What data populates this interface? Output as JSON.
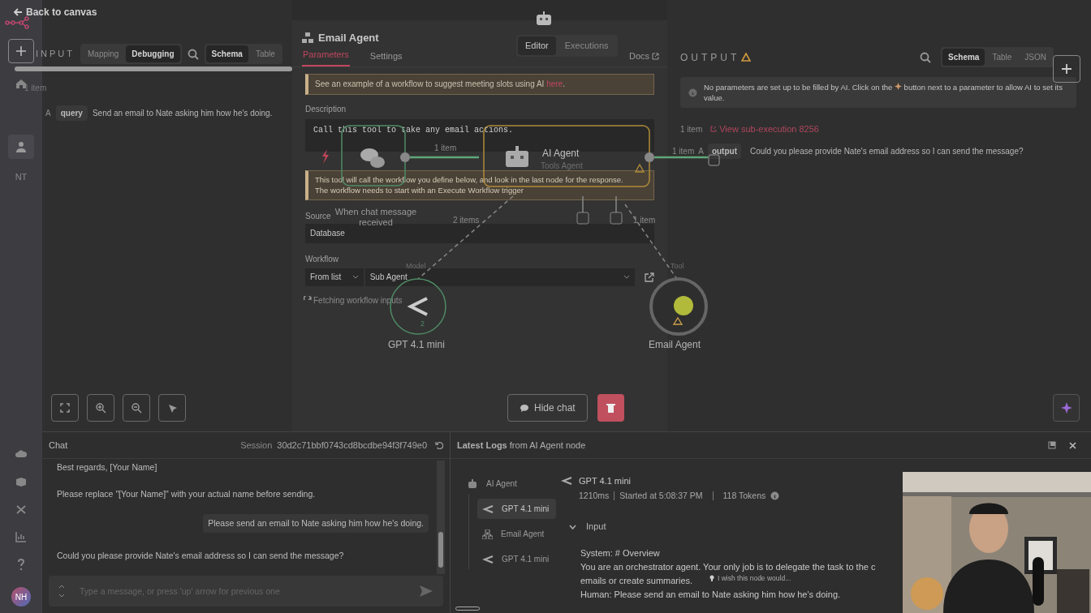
{
  "top_bar": {
    "back_link": "Back to canvas"
  },
  "sidebar": {
    "top_items": [
      {
        "kind": "add",
        "selected": false
      },
      {
        "kind": "home",
        "selected": false
      },
      {
        "kind": "user",
        "selected": true
      }
    ],
    "workspace_label": "NT",
    "bottom_items": [
      {
        "kind": "cloud"
      },
      {
        "kind": "package"
      },
      {
        "kind": "variable"
      },
      {
        "kind": "chart"
      },
      {
        "kind": "help"
      }
    ],
    "avatar_initials": "NH"
  },
  "input_panel": {
    "title": "INPUT",
    "mode_tabs": [
      {
        "label": "Mapping",
        "selected": false
      },
      {
        "label": "Debugging",
        "selected": true
      }
    ],
    "view_tabs": [
      {
        "label": "Schema",
        "selected": true
      },
      {
        "label": "Table",
        "selected": false
      }
    ],
    "item_count": "1 item",
    "fields": [
      {
        "type_marker": "A",
        "name": "query",
        "value": "Send an email to Nate asking him how he's doing."
      }
    ]
  },
  "view_switch": [
    {
      "label": "Editor",
      "selected": true
    },
    {
      "label": "Executions",
      "selected": false
    }
  ],
  "node_panel": {
    "title": "Email Agent",
    "tabs": [
      {
        "label": "Parameters",
        "selected": true
      },
      {
        "label": "Settings",
        "selected": false
      }
    ],
    "docs_link": "Docs",
    "notice": {
      "text": "See an example of a workflow to suggest meeting slots using AI ",
      "link": "here",
      "end": "."
    },
    "description": {
      "label": "Description",
      "value": "Call this tool to take any email actions."
    },
    "warning_lines": [
      "This tool will call the workflow you define below, and look in the last node for the response.",
      "The workflow needs to start with an Execute Workflow trigger"
    ],
    "source": {
      "label": "Source",
      "value": "Database"
    },
    "workflow": {
      "label": "Workflow",
      "mode": "From list",
      "value": "Sub Agent"
    },
    "status": "Fetching workflow inputs"
  },
  "output_panel": {
    "title": "OUTPUT",
    "warning": true,
    "view_tabs": [
      {
        "label": "Schema",
        "selected": true
      },
      {
        "label": "Table",
        "selected": false
      },
      {
        "label": "JSON",
        "selected": false
      }
    ],
    "info": {
      "before": "No parameters are set up to be filled by AI. Click on the ",
      "after": " button next to a parameter to allow AI to set its value."
    },
    "item_count": "1 item",
    "sub_execution_link": "View sub-execution 8256",
    "rows": [
      {
        "item_count": "1 item",
        "type_marker": "A",
        "name": "output",
        "value": "Could you please provide Nate's email address so I can send the message?"
      }
    ]
  },
  "canvas": {
    "nodes": [
      {
        "kind": "trigger",
        "label": "When chat message received"
      },
      {
        "kind": "agent",
        "label": "AI Agent",
        "subtitle": "Tools Agent"
      },
      {
        "kind": "model",
        "label": "GPT 4.1 mini",
        "port_label": "Model",
        "run_count": "2"
      },
      {
        "kind": "tool",
        "label": "Email Agent",
        "port_label": "Tool"
      }
    ],
    "edge_labels": [
      "1 item",
      "2 items",
      "1 item"
    ],
    "hide_chat_button": "Hide chat"
  },
  "chat": {
    "title": "Chat",
    "session_label": "Session",
    "session_id": "30d2c71bbf0743cd8bcdbe94f3f749e0",
    "messages": [
      {
        "kind": "bot",
        "text": "Best regards, [Your Name]"
      },
      {
        "kind": "bot",
        "text": "Please replace \"[Your Name]\" with your actual name before sending."
      },
      {
        "kind": "user",
        "text": "Please send an email to Nate asking him how he's doing."
      },
      {
        "kind": "bot",
        "text": "Could you please provide Nate's email address so I can send the message?"
      }
    ],
    "placeholder": "Type a message, or press 'up' arrow for previous one"
  },
  "logs": {
    "title": "**Latest Logs** from AI Agent node",
    "tree": [
      {
        "kind": "agent",
        "label": "AI Agent",
        "selected": false,
        "children": [
          {
            "kind": "model",
            "label": "GPT 4.1 mini",
            "selected": true
          },
          {
            "kind": "workflow",
            "label": "Email Agent",
            "selected": false
          },
          {
            "kind": "model",
            "label": "GPT 4.1 mini",
            "selected": false
          }
        ]
      }
    ],
    "detail": {
      "title": "GPT 4.1 mini",
      "duration": "1210ms",
      "started": "Started at 5:08:37 PM",
      "tokens": "118 Tokens",
      "section": {
        "label": "Input",
        "expanded": true,
        "lines": [
          "System: # Overview",
          "You are an orchestrator agent. Your only job is to delegate the task to the c",
          "emails or create summaries.",
          "Human: Please send an email to Nate asking him how he's doing."
        ]
      }
    },
    "hint": "I wish this node would..."
  }
}
